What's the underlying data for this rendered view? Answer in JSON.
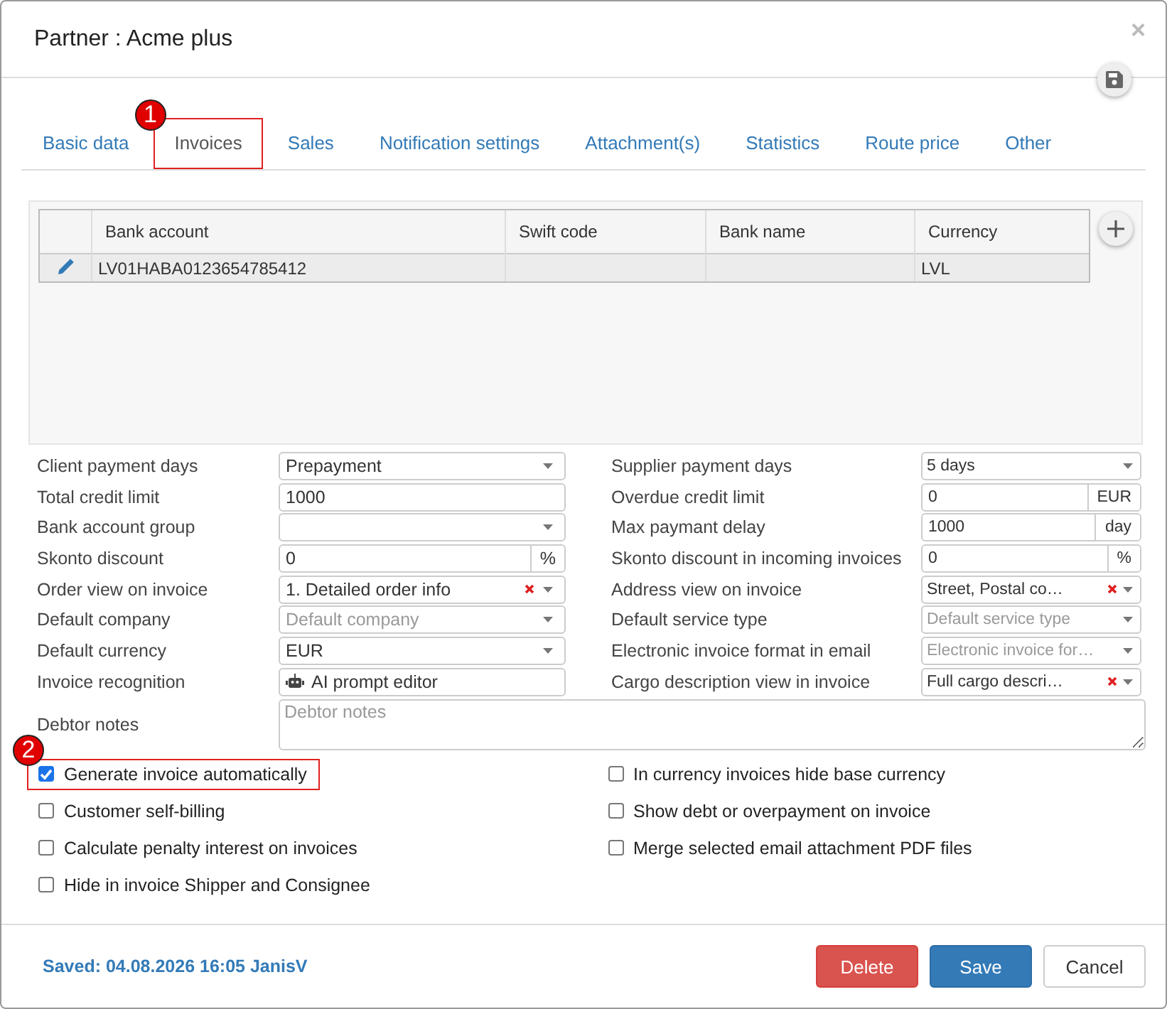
{
  "window": {
    "title": "Partner : Acme plus",
    "close": "×"
  },
  "tabs": [
    {
      "label": "Basic data",
      "selected": false
    },
    {
      "label": "Invoices",
      "selected": true,
      "marker": "1"
    },
    {
      "label": "Sales",
      "selected": false
    },
    {
      "label": "Notification settings",
      "selected": false
    },
    {
      "label": "Attachment(s)",
      "selected": false
    },
    {
      "label": "Statistics",
      "selected": false
    },
    {
      "label": "Route price",
      "selected": false
    },
    {
      "label": "Other",
      "selected": false
    }
  ],
  "table": {
    "columns": [
      "Bank account",
      "Swift code",
      "Bank name",
      "Currency"
    ],
    "rows": [
      {
        "cells": [
          "LV01HABA0123654785412",
          "",
          "",
          "LVL"
        ]
      }
    ]
  },
  "fields_left": [
    {
      "label": "Client payment days",
      "kind": "select",
      "value": "Prepayment"
    },
    {
      "label": "Total credit limit",
      "kind": "text",
      "value": "1000"
    },
    {
      "label": "Bank account group",
      "kind": "select"
    },
    {
      "label": "Skonto discount",
      "kind": "text",
      "value": "0",
      "addon": "%"
    },
    {
      "label": "Order view on invoice",
      "kind": "select_clearable",
      "value": "1. Detailed order info"
    },
    {
      "label": "Default company",
      "kind": "select",
      "placeholder": "Default company"
    },
    {
      "label": "Default currency",
      "kind": "select",
      "value": "EUR"
    },
    {
      "label": "Invoice recognition",
      "kind": "button",
      "value": "AI prompt editor"
    }
  ],
  "fields_right": [
    {
      "label": "Supplier payment days",
      "kind": "select",
      "value": "5 days"
    },
    {
      "label": "Overdue credit limit",
      "kind": "text",
      "value": "0",
      "addon": "EUR"
    },
    {
      "label": "Max paymant delay",
      "kind": "text",
      "value": "1000",
      "addon": "day"
    },
    {
      "label": "Skonto discount in incoming invoices",
      "kind": "text",
      "value": "0",
      "addon": "%"
    },
    {
      "label": "Address view on invoice",
      "kind": "select_clearable",
      "value": "Street, Postal co…"
    },
    {
      "label": "Default service type",
      "kind": "select",
      "placeholder": "Default service type"
    },
    {
      "label": "Electronic invoice format in email",
      "kind": "select",
      "placeholder": "Electronic invoice for…"
    },
    {
      "label": "Cargo description view in invoice",
      "kind": "select_clearable",
      "value": "Full cargo descri…"
    }
  ],
  "debtor_notes": {
    "label": "Debtor notes",
    "placeholder": "Debtor notes"
  },
  "checkboxes_left": [
    {
      "label": "Generate invoice automatically",
      "checked": true,
      "marker": "2"
    },
    {
      "label": "Customer self-billing",
      "checked": false
    },
    {
      "label": "Calculate penalty interest on invoices",
      "checked": false
    },
    {
      "label": "Hide in invoice Shipper and Consignee",
      "checked": false
    }
  ],
  "checkboxes_right": [
    {
      "label": "In currency invoices hide base currency",
      "checked": false
    },
    {
      "label": "Show debt or overpayment on invoice",
      "checked": false
    },
    {
      "label": "Merge selected email attachment PDF files",
      "checked": false
    }
  ],
  "status": "Saved: 04.08.2026 16:05 JanisV",
  "buttons": [
    {
      "label": "Delete",
      "kind": "danger"
    },
    {
      "label": "Save",
      "kind": "primary"
    },
    {
      "label": "Cancel",
      "kind": "default"
    }
  ]
}
